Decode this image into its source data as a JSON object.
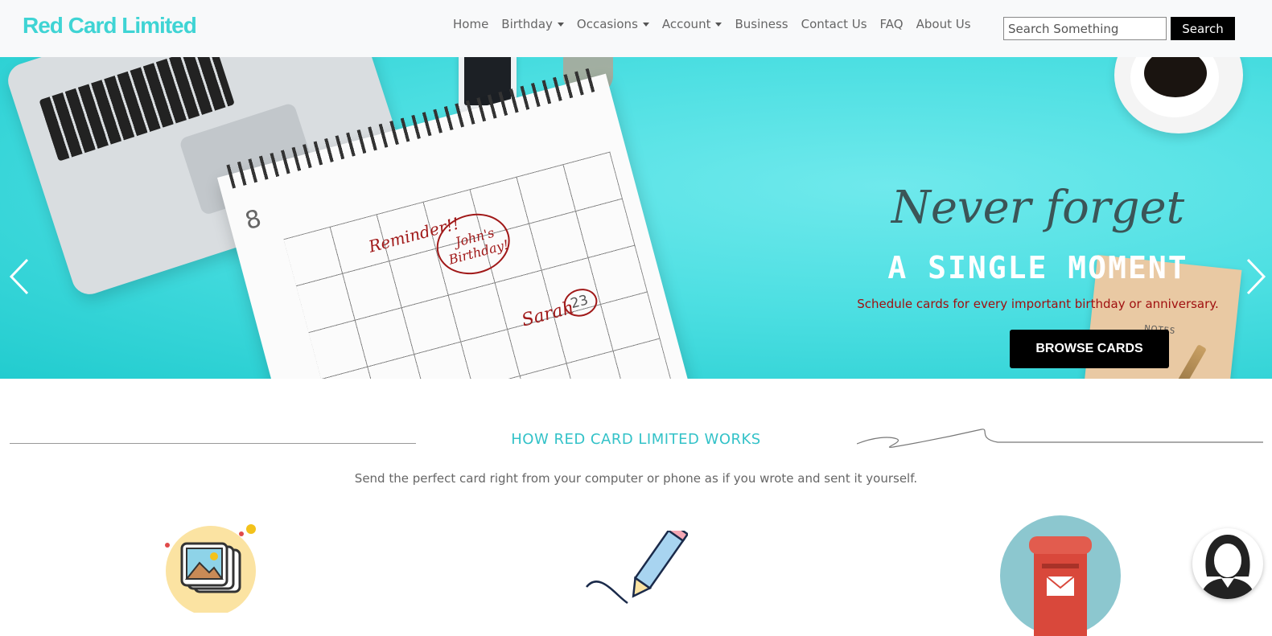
{
  "navbar": {
    "brand": "Red Card Limited",
    "links": [
      {
        "label": "Home",
        "dropdown": false
      },
      {
        "label": "Birthday",
        "dropdown": true
      },
      {
        "label": "Occasions",
        "dropdown": true
      },
      {
        "label": "Account",
        "dropdown": true
      },
      {
        "label": "Business",
        "dropdown": false
      },
      {
        "label": "Contact Us",
        "dropdown": false
      },
      {
        "label": "FAQ",
        "dropdown": false
      },
      {
        "label": "About Us",
        "dropdown": false
      }
    ],
    "search": {
      "placeholder": "Search Something",
      "button_label": "Search"
    }
  },
  "hero": {
    "script_text": "Never forget",
    "title": "A SINGLE MOMENT",
    "subtitle": "Schedule cards for every important birthday or anniversary.",
    "button_label": "BROWSE CARDS",
    "slide_count": 3,
    "active_slide": 0,
    "calendar": {
      "month_number": "8",
      "reminder": "Reminder!!",
      "event": "John's Birthday!",
      "name": "Sarah",
      "circled_day": "23"
    },
    "notes_label": "NOTES"
  },
  "how": {
    "title": "HOW RED CARD LIMITED WORKS",
    "subtitle": "Send the perfect card right from your computer or phone as if you wrote and sent it yourself."
  },
  "colors": {
    "brand": "#3fd4d4",
    "hero_bg": "#4ddfe2",
    "accent_text": "#33c2c8",
    "subtitle_red": "#a01010"
  }
}
